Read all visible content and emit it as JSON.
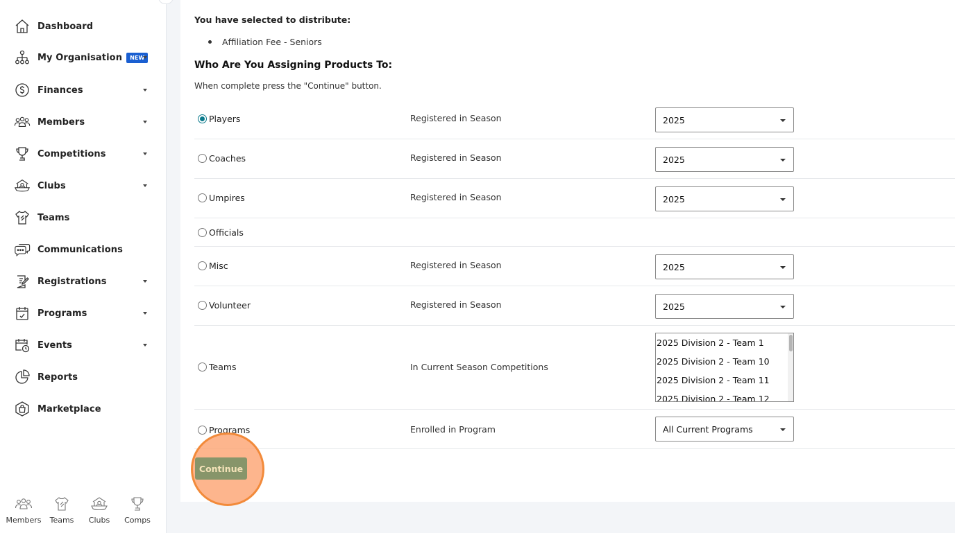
{
  "sidebar": {
    "items": [
      {
        "label": "Dashboard",
        "icon": "home-icon",
        "caret": false
      },
      {
        "label": "My Organisation",
        "icon": "org-chart-icon",
        "caret": true,
        "badge": "NEW"
      },
      {
        "label": "Finances",
        "icon": "dollar-icon",
        "caret": true
      },
      {
        "label": "Members",
        "icon": "members-icon",
        "caret": true
      },
      {
        "label": "Competitions",
        "icon": "trophy-icon",
        "caret": true
      },
      {
        "label": "Clubs",
        "icon": "clubhouse-icon",
        "caret": true
      },
      {
        "label": "Teams",
        "icon": "jersey-icon",
        "caret": false
      },
      {
        "label": "Communications",
        "icon": "chat-icon",
        "caret": false
      },
      {
        "label": "Registrations",
        "icon": "clipboard-icon",
        "caret": true
      },
      {
        "label": "Programs",
        "icon": "calendar-icon",
        "caret": true
      },
      {
        "label": "Events",
        "icon": "calendar-clock-icon",
        "caret": true
      },
      {
        "label": "Reports",
        "icon": "pie-chart-icon",
        "caret": false
      },
      {
        "label": "Marketplace",
        "icon": "shopping-bag-icon",
        "caret": false
      }
    ]
  },
  "quicknav": {
    "members": "Members",
    "teams": "Teams",
    "clubs": "Clubs",
    "comps": "Comps"
  },
  "main": {
    "selected_title": "You have selected to distribute:",
    "selected_items": [
      "Affiliation Fee - Seniors"
    ],
    "section_title": "Who Are You Assigning Products To:",
    "instruction": "When complete press the \"Continue\" button.",
    "options": [
      {
        "label": "Players",
        "checked": true,
        "criteria": "Registered in Season",
        "value": "2025"
      },
      {
        "label": "Coaches",
        "checked": false,
        "criteria": "Registered in Season",
        "value": "2025"
      },
      {
        "label": "Umpires",
        "checked": false,
        "criteria": "Registered in Season",
        "value": "2025"
      },
      {
        "label": "Officials",
        "checked": false,
        "criteria": "",
        "value": ""
      },
      {
        "label": "Misc",
        "checked": false,
        "criteria": "Registered in Season",
        "value": "2025"
      },
      {
        "label": "Volunteer",
        "checked": false,
        "criteria": "Registered in Season",
        "value": "2025"
      },
      {
        "label": "Teams",
        "checked": false,
        "criteria": "In Current Season Competitions",
        "list": [
          "2025 Division 2 - Team 1",
          "2025 Division 2 - Team 10",
          "2025 Division 2 - Team 11",
          "2025 Division 2 - Team 12"
        ]
      },
      {
        "label": "Programs",
        "checked": false,
        "criteria": "Enrolled in Program",
        "value": "All Current Programs"
      }
    ],
    "continue_label": "Continue"
  },
  "colors": {
    "radio_checked": "#0b7a8c",
    "badge": "#1a5fd1",
    "continue_button": "#87956a",
    "highlight": "#f28a3a"
  }
}
